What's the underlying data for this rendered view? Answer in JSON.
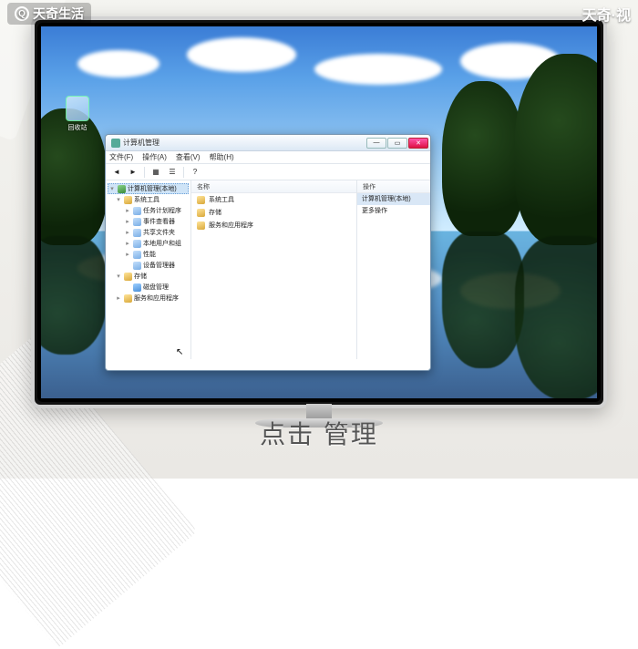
{
  "branding": {
    "left": "天奇生活",
    "right": "天奇·视"
  },
  "subtitle": "点击 管理",
  "desktop": {
    "recycle_label": "回收站"
  },
  "window": {
    "title": "计算机管理",
    "menu": [
      "文件(F)",
      "操作(A)",
      "查看(V)",
      "帮助(H)"
    ],
    "tree": {
      "root": "计算机管理(本地)",
      "group1": "系统工具",
      "g1_items": [
        "任务计划程序",
        "事件查看器",
        "共享文件夹",
        "本地用户和组",
        "性能",
        "设备管理器"
      ],
      "group2": "存储",
      "g2_items": [
        "磁盘管理"
      ],
      "group3": "服务和应用程序"
    },
    "center": {
      "header": "名称",
      "items": [
        "系统工具",
        "存储",
        "服务和应用程序"
      ]
    },
    "right": {
      "header": "操作",
      "action_title": "计算机管理(本地)",
      "more": "更多操作"
    }
  }
}
